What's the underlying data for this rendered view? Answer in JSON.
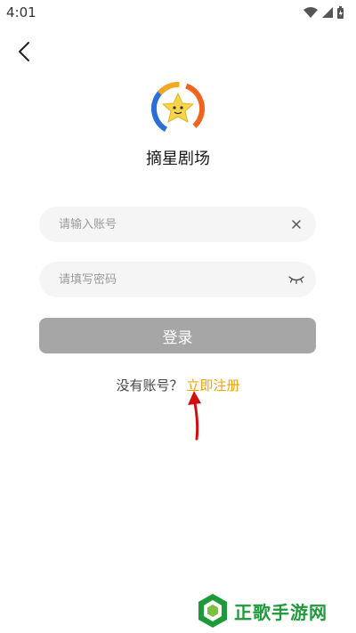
{
  "status_bar": {
    "time": "4:01",
    "icons": [
      "wifi-icon",
      "signal-icon",
      "battery-icon"
    ]
  },
  "nav": {
    "back_icon": "chevron-left-icon"
  },
  "app": {
    "name": "摘星剧场",
    "logo_icon": "star-logo-icon"
  },
  "form": {
    "account": {
      "placeholder": "请输入账号",
      "value": "",
      "clear_icon": "close-icon"
    },
    "password": {
      "placeholder": "请填写密码",
      "value": "",
      "toggle_icon": "eye-closed-icon"
    },
    "login_label": "登录"
  },
  "register": {
    "prompt": "没有账号？",
    "link_label": "立即注册"
  },
  "watermark": {
    "text": "正歌手游网"
  },
  "colors": {
    "accent": "#f5a000",
    "button_disabled": "#a6a6a6",
    "field_bg": "#f5f5f5",
    "annotation_arrow": "#d01010",
    "watermark_green": "#1f9a3a"
  }
}
